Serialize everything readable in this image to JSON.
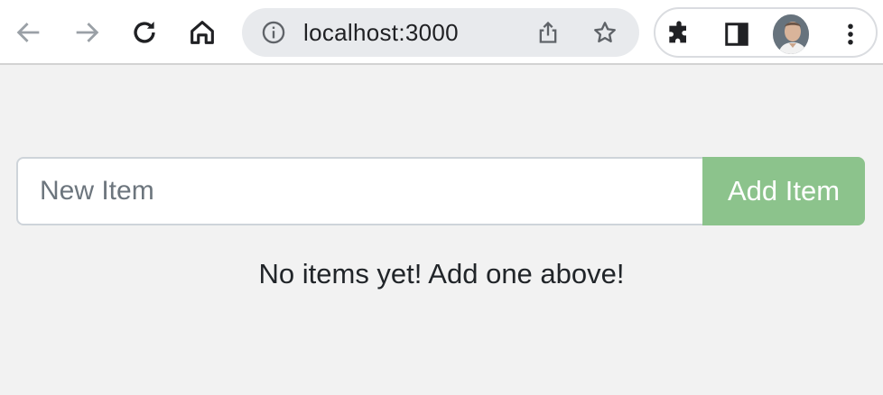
{
  "browser": {
    "url": "localhost:3000",
    "icons": {
      "back": "arrow-left-icon",
      "forward": "arrow-right-icon",
      "reload": "reload-icon",
      "home": "home-icon",
      "site_info": "info-icon",
      "share": "share-icon",
      "bookmark": "star-icon",
      "extensions": "puzzle-icon",
      "side_panel": "side-panel-icon",
      "profile": "avatar",
      "menu": "kebab-menu-icon"
    }
  },
  "app": {
    "input_placeholder": "New Item",
    "input_value": "",
    "add_button_label": "Add Item",
    "empty_message": "No items yet! Add one above!",
    "colors": {
      "button": "#8cc38c",
      "background": "#f2f2f2"
    }
  }
}
